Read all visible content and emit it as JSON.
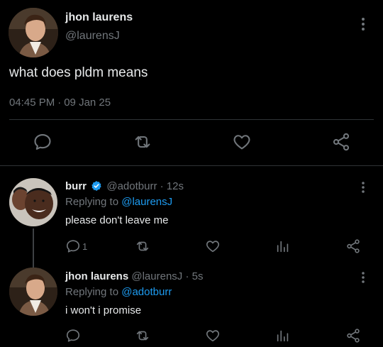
{
  "colors": {
    "background": "#000000",
    "text": "#e7e9ea",
    "secondary": "#71767b",
    "accent": "#1d9bf0",
    "divider": "#2f3336"
  },
  "main_tweet": {
    "author_name": "jhon laurens",
    "author_handle": "@laurensJ",
    "text": "what does pldm means",
    "time": "04:45 PM",
    "separator": "·",
    "date": "09 Jan 25",
    "actions": [
      "reply-icon",
      "retweet-icon",
      "like-icon",
      "share-icon"
    ]
  },
  "replies": [
    {
      "author_name": "burr",
      "verified": true,
      "author_handle": "@adotburr",
      "separator": "·",
      "time": "12s",
      "replying_prefix": "Replying to",
      "replying_to": "@laurensJ",
      "text": "please don't leave me",
      "reply_count": "1",
      "actions": [
        "reply-icon",
        "retweet-icon",
        "like-icon",
        "analytics-icon",
        "share-icon"
      ]
    },
    {
      "author_name": "jhon laurens",
      "verified": false,
      "author_handle": "@laurensJ",
      "separator": "·",
      "time": "5s",
      "replying_prefix": "Replying to",
      "replying_to": "@adotburr",
      "text": "i won't i promise",
      "reply_count": "",
      "actions": [
        "reply-icon",
        "retweet-icon",
        "like-icon",
        "analytics-icon",
        "share-icon"
      ]
    }
  ]
}
